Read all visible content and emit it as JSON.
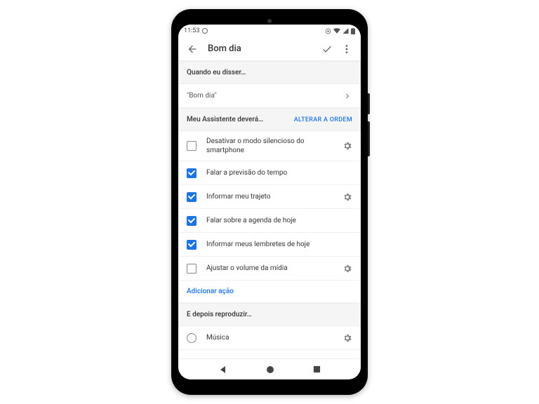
{
  "status": {
    "time": "11:53"
  },
  "header": {
    "title": "Bom dia"
  },
  "phrase": {
    "section_label": "Quando eu disser…",
    "value": "\"Bom dia\""
  },
  "actions": {
    "section_label": "Meu Assistente deverá…",
    "reorder_label": "ALTERAR A ORDEM",
    "items": [
      {
        "label": "Desativar o modo silencioso do smartphone",
        "checked": false,
        "settings": true
      },
      {
        "label": "Falar a previsão do tempo",
        "checked": true,
        "settings": false
      },
      {
        "label": "Informar meu trajeto",
        "checked": true,
        "settings": true
      },
      {
        "label": "Falar sobre a agenda de hoje",
        "checked": true,
        "settings": false
      },
      {
        "label": "Informar meus lembretes de hoje",
        "checked": true,
        "settings": false
      },
      {
        "label": "Ajustar o volume da mídia",
        "checked": false,
        "settings": true
      }
    ],
    "add_label": "Adicionar ação"
  },
  "after": {
    "section_label": "E depois reproduzir…",
    "items": [
      {
        "label": "Música",
        "selected": false,
        "settings": true
      }
    ]
  }
}
